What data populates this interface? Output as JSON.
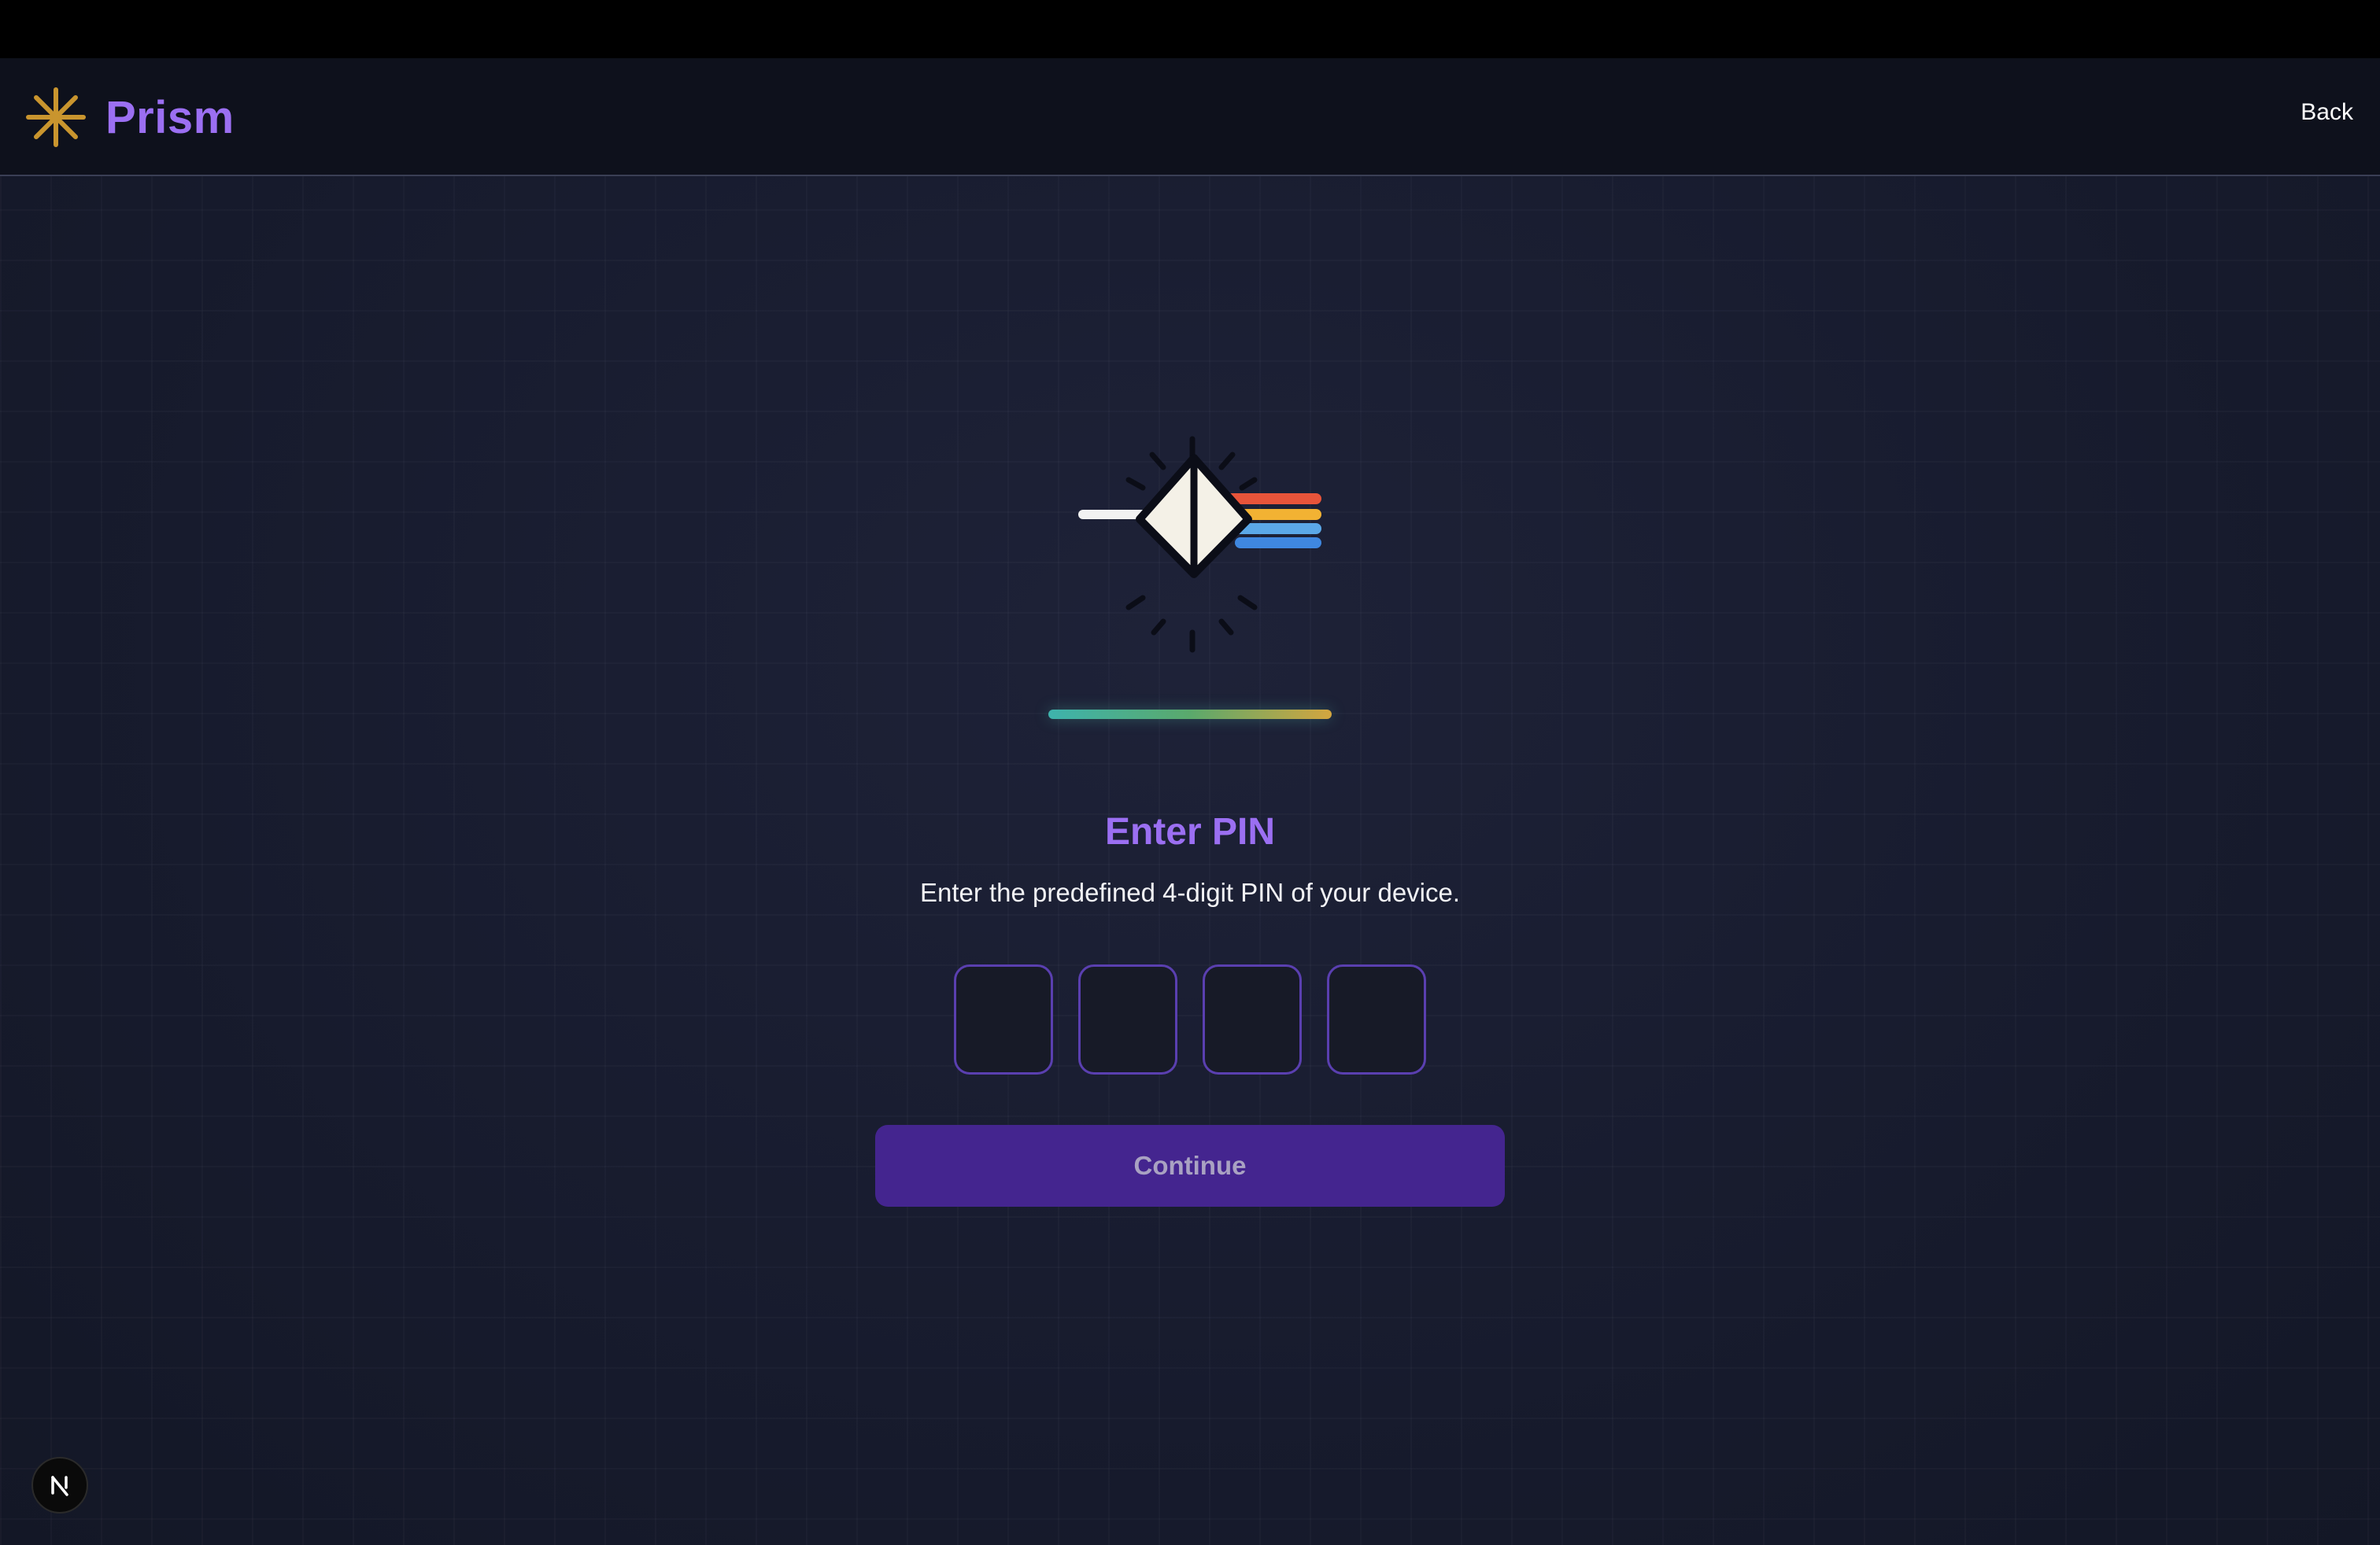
{
  "header": {
    "brand_name": "Prism",
    "brand_icon": "sparkle-asterisk-icon",
    "back_label": "Back"
  },
  "hero": {
    "icon": "prism-rainbow-icon",
    "loader_colors": [
      "#3eb3ad",
      "#5aa96c",
      "#d4a63f"
    ]
  },
  "pin_form": {
    "title": "Enter PIN",
    "subtitle": "Enter the predefined 4-digit PIN of your device.",
    "digits": [
      "",
      "",
      "",
      ""
    ],
    "continue_label": "Continue"
  },
  "dev_indicator": {
    "icon": "nextjs-n-icon"
  },
  "colors": {
    "accent": "#9b6ff2",
    "button_bg": "#44258f",
    "pin_border": "#5a3fb0",
    "brand_icon": "#c9952e",
    "rainbow": [
      "#e8543a",
      "#f2b233",
      "#5ba8e8",
      "#3f87e0"
    ]
  }
}
